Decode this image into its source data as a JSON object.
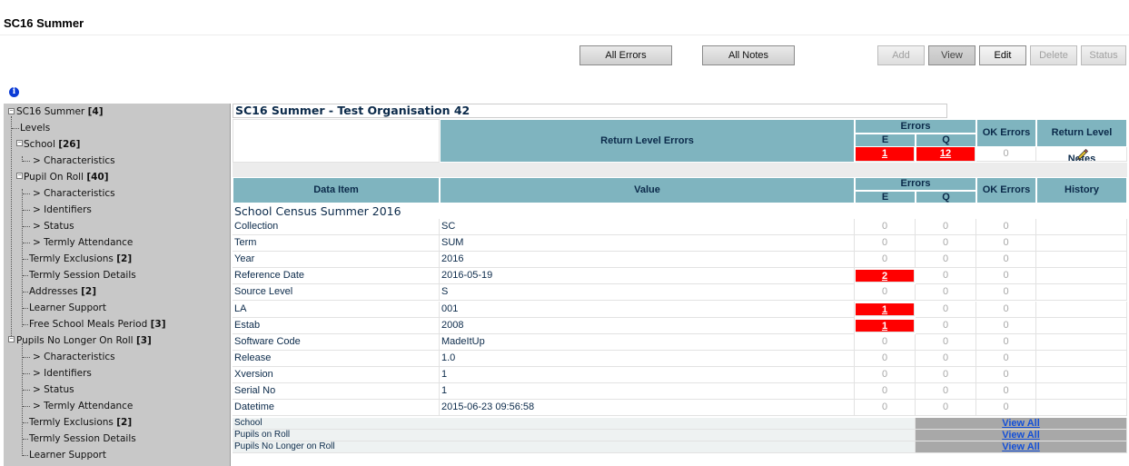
{
  "page": {
    "title": "SC16 Summer"
  },
  "toolbar": {
    "all_errors": "All Errors",
    "all_notes": "All Notes",
    "add": "Add",
    "view": "View",
    "edit": "Edit",
    "delete": "Delete",
    "status": "Status"
  },
  "sidebar": {
    "items": [
      {
        "label": "SC16 Summer",
        "count": "[4]"
      },
      {
        "label": "Levels",
        "count": ""
      },
      {
        "label": "School",
        "count": "[26]"
      },
      {
        "label": "> Characteristics",
        "count": ""
      },
      {
        "label": "Pupil On Roll",
        "count": "[40]"
      },
      {
        "label": "> Characteristics",
        "count": ""
      },
      {
        "label": "> Identifiers",
        "count": ""
      },
      {
        "label": "> Status",
        "count": ""
      },
      {
        "label": "> Termly Attendance",
        "count": ""
      },
      {
        "label": "Termly Exclusions",
        "count": "[2]"
      },
      {
        "label": "Termly Session Details",
        "count": ""
      },
      {
        "label": "Addresses",
        "count": "[2]"
      },
      {
        "label": "Learner Support",
        "count": ""
      },
      {
        "label": "Free School Meals Period",
        "count": "[3]"
      },
      {
        "label": "Pupils No Longer On Roll",
        "count": "[3]"
      },
      {
        "label": "> Characteristics",
        "count": ""
      },
      {
        "label": "> Identifiers",
        "count": ""
      },
      {
        "label": "> Status",
        "count": ""
      },
      {
        "label": "> Termly Attendance",
        "count": ""
      },
      {
        "label": "Termly Exclusions",
        "count": "[2]"
      },
      {
        "label": "Termly Session Details",
        "count": ""
      },
      {
        "label": "Learner Support",
        "count": ""
      }
    ]
  },
  "main": {
    "org_title": "SC16 Summer - Test Organisation 42",
    "return_level": {
      "label": "Return Level Errors",
      "errors_header": "Errors",
      "e_header": "E",
      "q_header": "Q",
      "ok_errors_header": "OK Errors",
      "notes_header": "Return Level Notes",
      "e_value": "1",
      "q_value": "12",
      "ok_value": "0"
    },
    "columns": {
      "data_item": "Data Item",
      "value": "Value",
      "errors": "Errors",
      "e": "E",
      "q": "Q",
      "ok_errors": "OK Errors",
      "history": "History"
    },
    "section_title": "School Census Summer 2016",
    "rows": [
      {
        "item": "Collection",
        "value": "SC",
        "e": "0",
        "q": "0",
        "ok": "0",
        "e_err": false
      },
      {
        "item": "Term",
        "value": "SUM",
        "e": "0",
        "q": "0",
        "ok": "0",
        "e_err": false
      },
      {
        "item": "Year",
        "value": "2016",
        "e": "0",
        "q": "0",
        "ok": "0",
        "e_err": false
      },
      {
        "item": "Reference Date",
        "value": "2016-05-19",
        "e": "2",
        "q": "0",
        "ok": "0",
        "e_err": true
      },
      {
        "item": "Source Level",
        "value": "S",
        "e": "0",
        "q": "0",
        "ok": "0",
        "e_err": false
      },
      {
        "item": "LA",
        "value": "001",
        "e": "1",
        "q": "0",
        "ok": "0",
        "e_err": true
      },
      {
        "item": "Estab",
        "value": "2008",
        "e": "1",
        "q": "0",
        "ok": "0",
        "e_err": true
      },
      {
        "item": "Software Code",
        "value": "MadeItUp",
        "e": "0",
        "q": "0",
        "ok": "0",
        "e_err": false
      },
      {
        "item": "Release",
        "value": "1.0",
        "e": "0",
        "q": "0",
        "ok": "0",
        "e_err": false
      },
      {
        "item": "Xversion",
        "value": "1",
        "e": "0",
        "q": "0",
        "ok": "0",
        "e_err": false
      },
      {
        "item": "Serial No",
        "value": "1",
        "e": "0",
        "q": "0",
        "ok": "0",
        "e_err": false
      },
      {
        "item": "Datetime",
        "value": "2015-06-23 09:56:58",
        "e": "0",
        "q": "0",
        "ok": "0",
        "e_err": false
      }
    ],
    "links": [
      {
        "label": "School",
        "action": "View All"
      },
      {
        "label": "Pupils on Roll",
        "action": "View All"
      },
      {
        "label": "Pupils No Longer on Roll",
        "action": "View All"
      }
    ]
  },
  "colors": {
    "header_bg": "#7fb4bf",
    "error_red": "#ff0000",
    "sidebar_bg": "#c8c8c8",
    "link_blue": "#1450d8"
  }
}
